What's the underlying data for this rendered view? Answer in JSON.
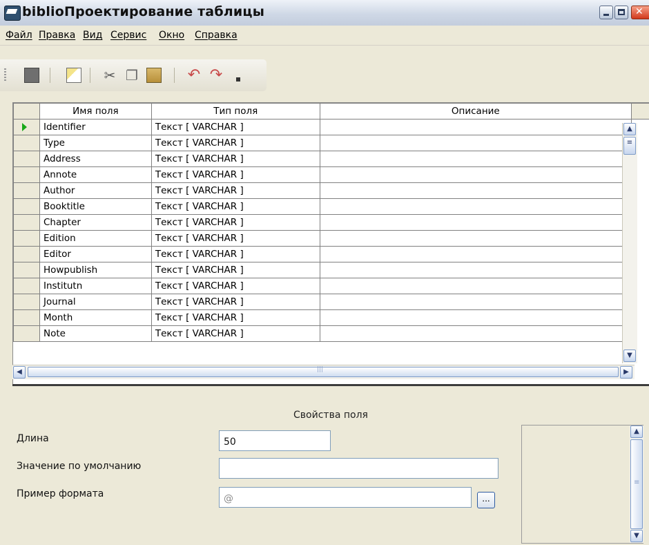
{
  "window": {
    "title": "biblioПроектирование таблицы"
  },
  "menu": [
    "Файл",
    "Правка",
    "Вид",
    "Сервис",
    "Окно",
    "Справка"
  ],
  "toolbar": {
    "icons": [
      "save-icon",
      "design-icon",
      "cut-icon",
      "copy-icon",
      "paste-icon",
      "undo-icon",
      "redo-icon",
      "more-icon"
    ]
  },
  "grid": {
    "columns": [
      "Имя поля",
      "Тип поля",
      "Описание"
    ],
    "rows": [
      {
        "name": "Identifier",
        "type": "Текст [ VARCHAR ]",
        "desc": ""
      },
      {
        "name": "Type",
        "type": "Текст [ VARCHAR ]",
        "desc": ""
      },
      {
        "name": "Address",
        "type": "Текст [ VARCHAR ]",
        "desc": ""
      },
      {
        "name": "Annote",
        "type": "Текст [ VARCHAR ]",
        "desc": ""
      },
      {
        "name": "Author",
        "type": "Текст [ VARCHAR ]",
        "desc": ""
      },
      {
        "name": "Booktitle",
        "type": "Текст [ VARCHAR ]",
        "desc": ""
      },
      {
        "name": "Chapter",
        "type": "Текст [ VARCHAR ]",
        "desc": ""
      },
      {
        "name": "Edition",
        "type": "Текст [ VARCHAR ]",
        "desc": ""
      },
      {
        "name": "Editor",
        "type": "Текст [ VARCHAR ]",
        "desc": ""
      },
      {
        "name": "Howpublish",
        "type": "Текст [ VARCHAR ]",
        "desc": ""
      },
      {
        "name": "Institutn",
        "type": "Текст [ VARCHAR ]",
        "desc": ""
      },
      {
        "name": "Journal",
        "type": "Текст [ VARCHAR ]",
        "desc": ""
      },
      {
        "name": "Month",
        "type": "Текст [ VARCHAR ]",
        "desc": ""
      },
      {
        "name": "Note",
        "type": "Текст [ VARCHAR ]",
        "desc": ""
      }
    ]
  },
  "properties": {
    "title": "Свойства поля",
    "length_label": "Длина",
    "length_value": "50",
    "default_label": "Значение по умолчанию",
    "default_value": "",
    "format_label": "Пример формата",
    "format_value": "@",
    "format_button": "..."
  }
}
